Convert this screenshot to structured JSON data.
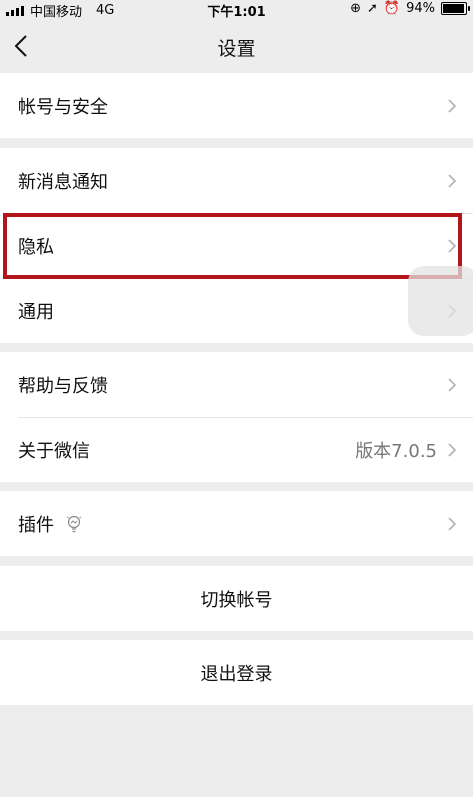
{
  "status": {
    "carrier": "中国移动",
    "network": "4G",
    "time": "下午1:01",
    "battery_percent": "94%",
    "battery_level": 0.94
  },
  "nav": {
    "title": "设置"
  },
  "groups": {
    "account": {
      "account_security": "帐号与安全"
    },
    "general": {
      "new_message": "新消息通知",
      "privacy": "隐私",
      "general": "通用"
    },
    "help": {
      "feedback": "帮助与反馈",
      "about": "关于微信",
      "version": "版本7.0.5"
    },
    "plugins": {
      "label": "插件"
    },
    "switch_account": "切换帐号",
    "logout": "退出登录"
  },
  "colors": {
    "background": "#ededed",
    "highlight": "#b3141a"
  }
}
